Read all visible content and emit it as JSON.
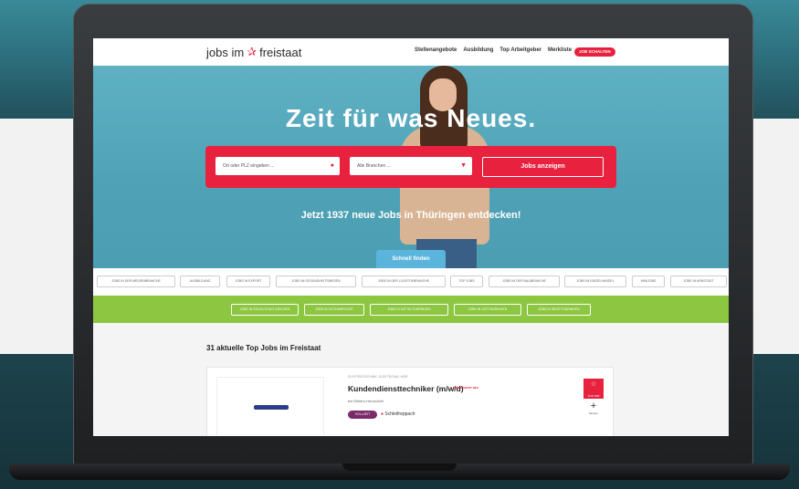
{
  "site": {
    "logo_left": "jobs im",
    "logo_star": "✰",
    "logo_right": "freistaat"
  },
  "nav": {
    "links": [
      "Stellenangebote",
      "Ausbildung",
      "Top Arbeitgeber",
      "Merkliste"
    ],
    "cta": "JOB SCHALTEN"
  },
  "hero": {
    "title": "Zeit für was Neues.",
    "location_placeholder": "Ort oder PLZ eingeben ...",
    "branch_placeholder": "Alle Branchen ...",
    "search_button": "Jobs anzeigen",
    "subtitle": "Jetzt 1937 neue Jobs in Thüringen entdecken!",
    "tab": "Schnell finden"
  },
  "categories": [
    "JOBS IN DER MEDIENBRANCHE",
    "AUSBILDUNG",
    "JOBS IN EXPORT",
    "JOBS IM GESUNDHEITSWESEN",
    "JOBS IN DER LOGISTIKBRANCHE",
    "TOP JOBS",
    "JOBS IM DER BAUBRANCHE",
    "JOBS IM EINZELHANDEL",
    "MINIJOBS",
    "JOBS IN ARNSTADT"
  ],
  "green_categories": [
    "JOBS IN RUDOLSTADT-KIRCHEN",
    "JOBS IN GOTHA/ERFURT",
    "JOBS IN MITTELTHÜRINGEN",
    "JOBS IN OSTTHÜRINGEN",
    "JOBS IN WESTTHÜRINGEN"
  ],
  "listing": {
    "title": "31 aktuelle Top Jobs im Freistaat",
    "job": {
      "category": "ELEKTROTECHNIK, ELEKTRONIK, MSR",
      "title": "Kundendiensttechniker (m/w/d)",
      "new_badge": "TOPANGEBOT NEU",
      "company": "bei Elektro-Herrschaft",
      "tag": "VOLLZEIT",
      "location": "Schleifreppach",
      "top_badge": "TOP JOB",
      "bookmark_label": "Merken"
    }
  },
  "colors": {
    "brand_red": "#e8213f",
    "hero_blue": "#5fb0c3",
    "green_bar": "#8dc640",
    "tag_purple": "#7b2a6b"
  }
}
